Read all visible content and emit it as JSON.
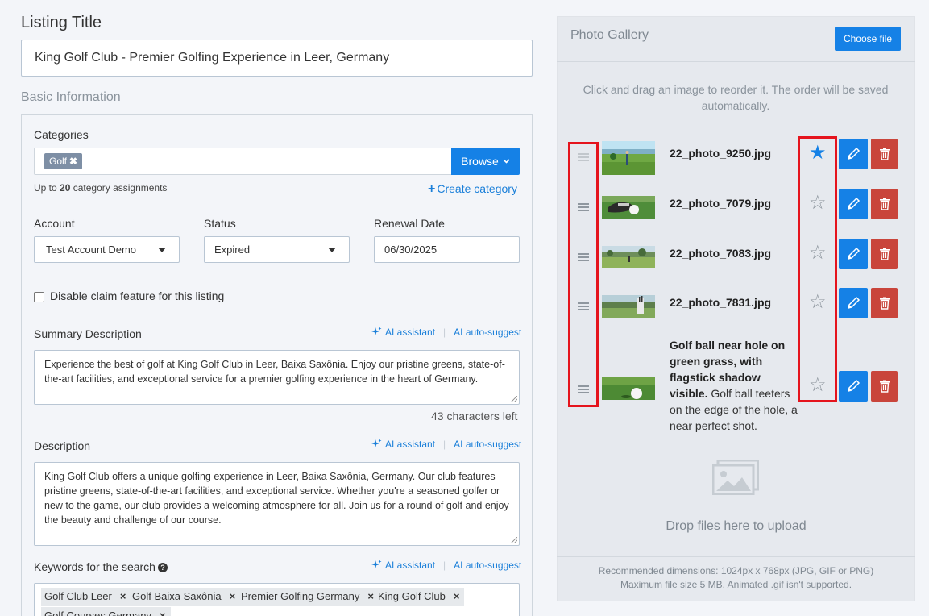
{
  "listing": {
    "heading": "Listing Title",
    "title_value": "King Golf Club - Premier Golfing Experience in Leer, Germany",
    "section_heading": "Basic Information"
  },
  "categories": {
    "label": "Categories",
    "selected_tag": "Golf",
    "tag_remove": "✖",
    "browse_label": "Browse",
    "limit_prefix": "Up to ",
    "limit_count": "20",
    "limit_suffix": " category assignments",
    "create_label": "Create category"
  },
  "account": {
    "label": "Account",
    "value": "Test Account Demo"
  },
  "status": {
    "label": "Status",
    "value": "Expired"
  },
  "renewal": {
    "label": "Renewal Date",
    "value": "06/30/2025"
  },
  "claim": {
    "label": "Disable claim feature for this listing",
    "checked": false
  },
  "ai": {
    "assistant": "AI assistant",
    "autosuggest": "AI auto-suggest",
    "sep": "|"
  },
  "summary": {
    "label": "Summary Description",
    "text": "Experience the best of golf at King Golf Club in Leer, Baixa Saxônia. Enjoy our pristine greens, state-of-the-art facilities, and exceptional service for a premier golfing experience in the heart of Germany.",
    "chars_left": "43 characters left"
  },
  "description": {
    "label": "Description",
    "text": "King Golf Club offers a unique golfing experience in Leer, Baixa Saxônia, Germany. Our club features pristine greens, state-of-the-art facilities, and exceptional service. Whether you're a seasoned golfer or new to the game, our club provides a welcoming atmosphere for all. Join us for a round of golf and enjoy the beauty and challenge of our course."
  },
  "keywords": {
    "label": "Keywords for the search",
    "help": "?",
    "remove": "×",
    "tags": [
      "Golf Club Leer",
      "Golf Baixa Saxônia",
      "Premier Golfing Germany",
      "King Golf Club",
      "Golf Courses Germany"
    ]
  },
  "gallery": {
    "title": "Photo Gallery",
    "choose_label": "Choose file",
    "instructions": "Click and drag an image to reorder it. The order will be saved automatically.",
    "photos": [
      {
        "name": "22_photo_9250.jpg",
        "featured": true,
        "star": "★"
      },
      {
        "name": "22_photo_7079.jpg",
        "featured": false,
        "star": "☆"
      },
      {
        "name": "22_photo_7083.jpg",
        "featured": false,
        "star": "☆"
      },
      {
        "name": "22_photo_7831.jpg",
        "featured": false,
        "star": "☆"
      },
      {
        "name": "",
        "featured": false,
        "star": "☆",
        "caption_title": "Golf ball near hole on green grass, with flagstick shadow visible.",
        "caption_body": "Golf ball teeters on the edge of the hole, a near perfect shot."
      }
    ],
    "drop_text": "Drop files here to upload",
    "recommend": "Recommended dimensions: 1024px x 768px (JPG, GIF or PNG)",
    "max_size": "Maximum file size 5 MB. Animated .gif isn't supported."
  },
  "colors": {
    "primary": "#1581e6",
    "danger": "#c9453b",
    "highlight": "#e5141d",
    "tag": "#7e8fa5"
  }
}
